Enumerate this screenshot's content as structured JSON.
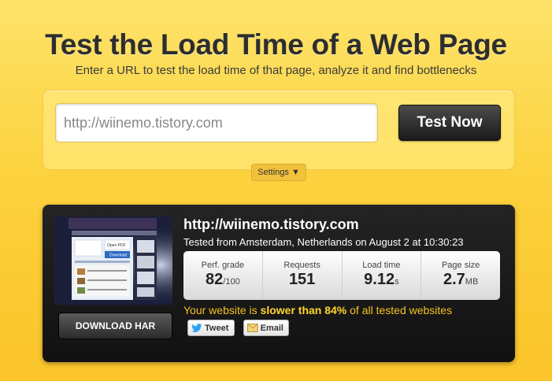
{
  "header": {
    "title": "Test the Load Time of a Web Page",
    "subtitle": "Enter a URL to test the load time of that page, analyze it and find bottlenecks"
  },
  "form": {
    "url_value": "http://wiinemo.tistory.com",
    "test_button": "Test Now",
    "settings_label": "Settings ▼"
  },
  "result": {
    "site_url": "http://wiinemo.tistory.com",
    "tested_from": "Tested from Amsterdam, Netherlands on August 2 at 10:30:23",
    "download_har": "DOWNLOAD HAR",
    "stats": [
      {
        "label": "Perf. grade",
        "value": "82",
        "unit": "/100"
      },
      {
        "label": "Requests",
        "value": "151",
        "unit": ""
      },
      {
        "label": "Load time",
        "value": "9.12",
        "unit": "s"
      },
      {
        "label": "Page size",
        "value": "2.7",
        "unit": "MB"
      }
    ],
    "comparison": {
      "prefix": "Your website is ",
      "highlight": "slower than 84%",
      "suffix": " of all tested websites"
    },
    "share": {
      "tweet": "Tweet",
      "email": "Email"
    },
    "thumbnail": {
      "open_pdf": "Open PDF",
      "download": "Download"
    }
  },
  "colors": {
    "background": "#fcd23e",
    "panel_dark": "#1a1a1a",
    "highlight": "#f4c21f"
  }
}
